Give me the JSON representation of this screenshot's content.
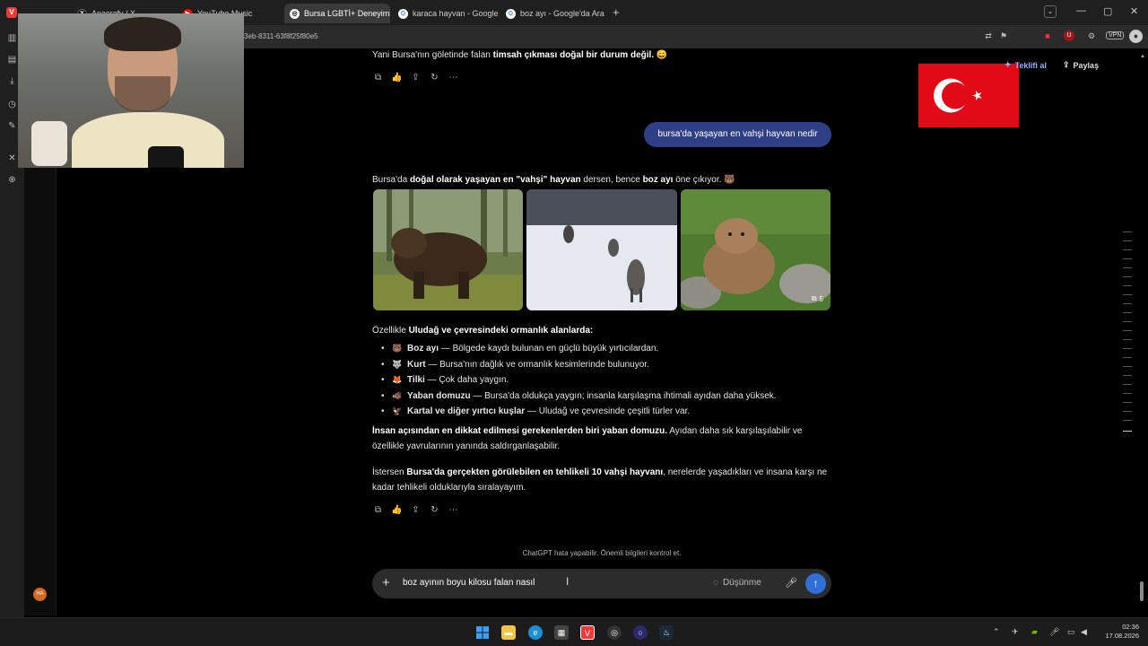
{
  "browser": {
    "tabs": [
      {
        "label": "Anacrafy / X"
      },
      {
        "label": "YouTube Music"
      },
      {
        "label": "Bursa LGBTİ+ Deneyimi Öz"
      },
      {
        "label": "karaca hayvan - Google'da"
      },
      {
        "label": "boz ayı - Google'da Ara"
      }
    ],
    "url": "3eb-8311-63f8f25f80e5",
    "vpn_label": "VPN"
  },
  "chat_header": {
    "invite_label": "Teklifi al",
    "share_label": "Paylaş"
  },
  "messages": {
    "prev_answer_lead": "Yani Bursa'nın göletinde falan ",
    "prev_answer_bold": "timsah çıkması doğal bir durum değil.",
    "prev_answer_emoji": "😄",
    "user_question": "bursa'da yaşayan en vahşi hayvan nedir",
    "answer_p1_a": "Bursa'da ",
    "answer_p1_b": "doğal olarak yaşayan en \"vahşi\" hayvan",
    "answer_p1_c": " dersen, bence ",
    "answer_p1_d": "boz ayı",
    "answer_p1_e": " öne çıkıyor. 🐻",
    "image_count": "5",
    "answer_p2_a": "Özellikle ",
    "answer_p2_b": "Uludağ ve çevresindeki ormanlık alanlarda:",
    "animals": [
      {
        "emoji": "🐻",
        "name": "Boz ayı",
        "desc": " — Bölgede kaydı bulunan en güçlü büyük yırtıcılardan."
      },
      {
        "emoji": "🐺",
        "name": "Kurt",
        "desc": " — Bursa'nın dağlık ve ormanlık kesimlerinde bulunuyor."
      },
      {
        "emoji": "🦊",
        "name": "Tilki",
        "desc": " — Çok daha yaygın."
      },
      {
        "emoji": "🐗",
        "name": "Yaban domuzu",
        "desc": " — Bursa'da oldukça yaygın; insanla karşılaşma ihtimali ayıdan daha yüksek."
      },
      {
        "emoji": "🦅",
        "name": "Kartal ve diğer yırtıcı kuşlar",
        "desc": " — Uludağ ve çevresinde çeşitli türler var."
      }
    ],
    "answer_p3_bold": "İnsan açısından en dikkat edilmesi gerekenlerden biri yaban domuzu.",
    "answer_p3_rest": " Ayıdan daha sık karşılaşılabilir ve özellikle yavrularının yanında saldırganlaşabilir.",
    "answer_p4_a": "İstersen ",
    "answer_p4_b": "Bursa'da gerçekten görülebilen en tehlikeli 10 vahşi hayvanı",
    "answer_p4_c": ", nerelerde yaşadıkları ve insana karşı ne kadar tehlikeli olduklarıyla sıralayayım."
  },
  "disclaimer": "ChatGPT hata yapabilir. Önemli bilgileri kontrol et.",
  "composer": {
    "value": "boz ayının boyu kilosu falan nasıl",
    "thinking_label": "Düşünme"
  },
  "user_avatar": "HA",
  "taskbar": {
    "time": "02:36",
    "date": "17.08.2026"
  },
  "colors": {
    "user_bubble": "#2f3f86",
    "send_button": "#2f6fd6",
    "flag_red": "#e30a17"
  }
}
